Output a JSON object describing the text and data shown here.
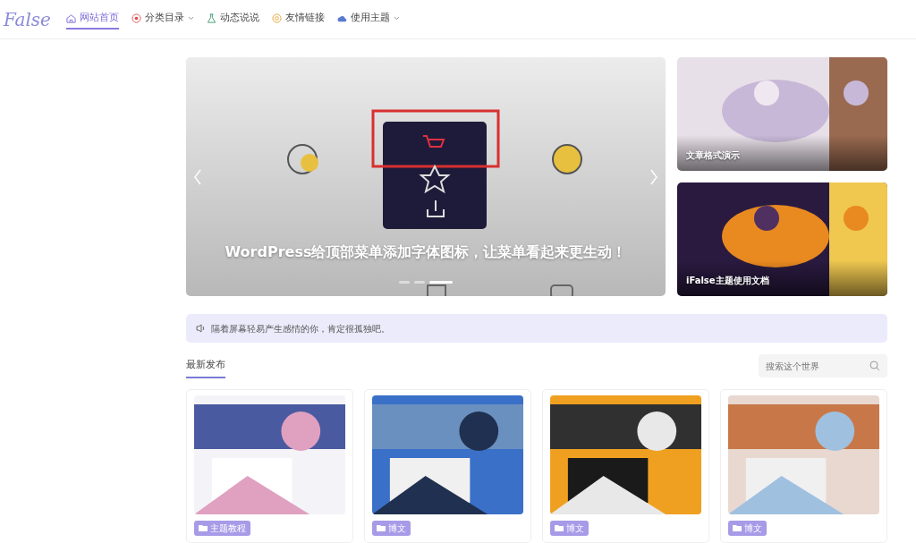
{
  "header": {
    "logo": "False",
    "nav": [
      {
        "label": "网站首页",
        "selected": true,
        "dropdown": false
      },
      {
        "label": "分类目录",
        "selected": false,
        "dropdown": true
      },
      {
        "label": "动态说说",
        "selected": false,
        "dropdown": false
      },
      {
        "label": "友情链接",
        "selected": false,
        "dropdown": false
      },
      {
        "label": "使用主题",
        "selected": false,
        "dropdown": true
      }
    ]
  },
  "slider": {
    "caption": "WordPress给顶部菜单添加字体图标，让菜单看起来更生动！",
    "dots": [
      {
        "selected": false
      },
      {
        "selected": false
      },
      {
        "selected": true
      }
    ]
  },
  "featured": [
    {
      "title": "文章格式演示"
    },
    {
      "title": "iFalse主题使用文档"
    }
  ],
  "notice": {
    "text": "隔着屏幕轻易产生感情的你，肯定很孤独吧。"
  },
  "section": {
    "tabs": [
      {
        "label": "最新发布",
        "selected": true
      }
    ],
    "search": {
      "placeholder": "搜索这个世界"
    }
  },
  "posts": [
    {
      "category": "主题教程"
    },
    {
      "category": "博文"
    },
    {
      "category": "博文"
    },
    {
      "category": "博文"
    }
  ]
}
